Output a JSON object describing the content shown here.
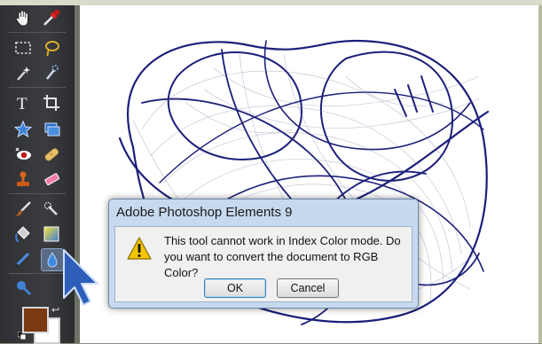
{
  "toolbox": {
    "tools": [
      {
        "name": "hand-tool-icon"
      },
      {
        "name": "eyedropper-tool-icon"
      },
      {
        "name": "marquee-tool-icon"
      },
      {
        "name": "lasso-tool-icon"
      },
      {
        "name": "magic-wand-tool-icon"
      },
      {
        "name": "quick-selection-tool-icon"
      },
      {
        "name": "type-tool-icon"
      },
      {
        "name": "crop-tool-icon"
      },
      {
        "name": "cookie-cutter-tool-icon"
      },
      {
        "name": "straighten-tool-icon"
      },
      {
        "name": "red-eye-tool-icon"
      },
      {
        "name": "healing-brush-tool-icon"
      },
      {
        "name": "clone-stamp-tool-icon"
      },
      {
        "name": "eraser-tool-icon"
      },
      {
        "name": "brush-tool-icon"
      },
      {
        "name": "smart-brush-tool-icon"
      },
      {
        "name": "paint-bucket-tool-icon"
      },
      {
        "name": "gradient-tool-icon"
      },
      {
        "name": "pencil-tool-icon"
      },
      {
        "name": "blur-tool-icon"
      },
      {
        "name": "sponge-tool-icon"
      }
    ],
    "foreground_color": "#7a3a12",
    "background_color": "#ffffff"
  },
  "dialog": {
    "title": "Adobe Photoshop Elements 9",
    "message": "This tool cannot work in Index Color mode. Do you want to convert the document to RGB Color?",
    "ok_label": "OK",
    "cancel_label": "Cancel"
  },
  "colors": {
    "accent": "#3c7fb1",
    "canvas_stroke": "#1b1f7a"
  }
}
